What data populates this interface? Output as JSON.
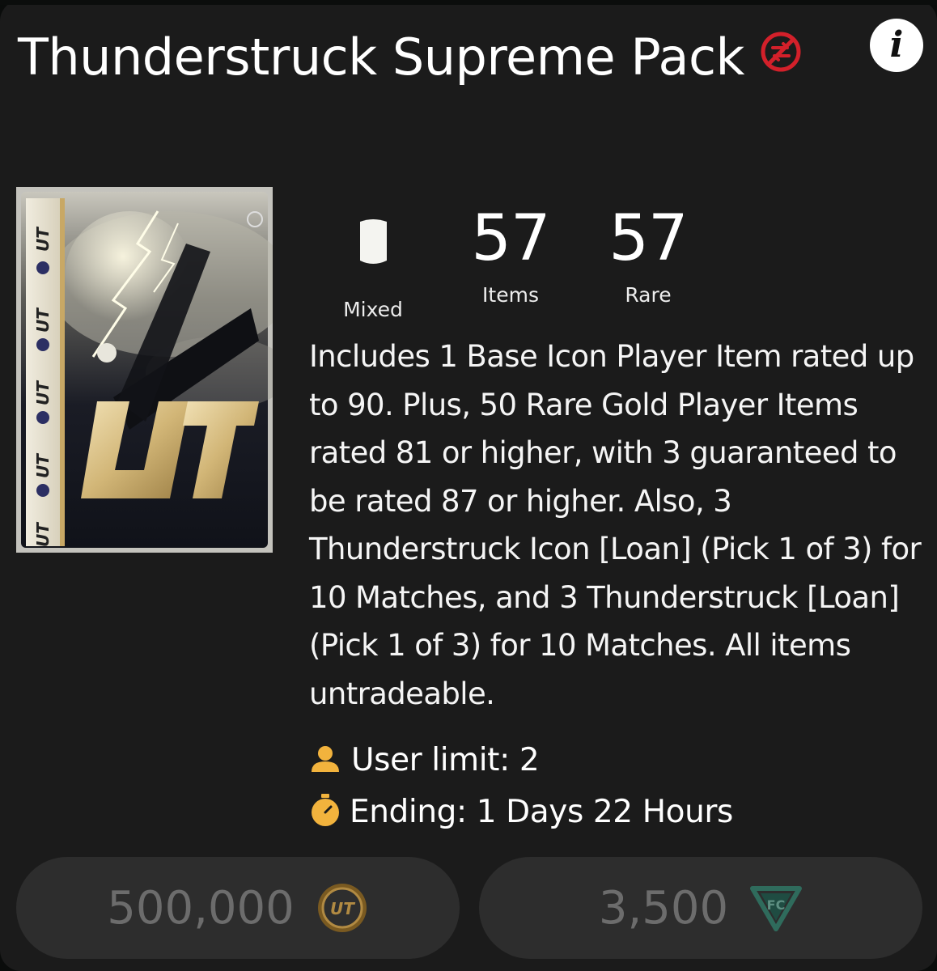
{
  "pack": {
    "title": "Thunderstruck Supreme Pack",
    "untradeable_icon": "untradeable-icon",
    "info_icon": "info-icon",
    "info_label": "i"
  },
  "stats": [
    {
      "value": "",
      "label": "Mixed",
      "icon": "shield-icon"
    },
    {
      "value": "57",
      "label": "Items"
    },
    {
      "value": "57",
      "label": "Rare"
    }
  ],
  "description": "Includes 1 Base Icon Player Item rated up to 90. Plus, 50 Rare Gold Player Items rated 81 or higher, with 3 guaranteed to be rated 87 or higher. Also, 3 Thunderstruck Icon [Loan] (Pick 1 of 3) for 10 Matches, and 3 Thunderstruck [Loan] (Pick 1 of 3) for 10 Matches. All items untradeable.",
  "limits": {
    "user_limit": "User limit: 2",
    "ending": "Ending: 1 Days 22 Hours"
  },
  "prices": {
    "coins": "500,000",
    "points": "3,500"
  },
  "colors": {
    "accent_gold": "#f2b33d",
    "untradeable_red": "#d3202a",
    "panel_bg": "#1b1b1b",
    "button_bg": "#2d2d2d"
  }
}
